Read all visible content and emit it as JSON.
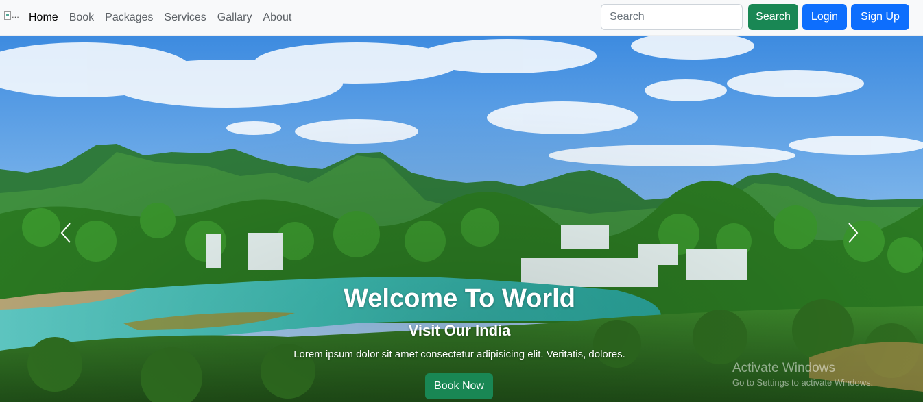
{
  "navbar": {
    "brand_alt": "...",
    "links": [
      "Home",
      "Book",
      "Packages",
      "Services",
      "Gallary",
      "About"
    ],
    "search_placeholder": "Search",
    "search_button": "Search",
    "login_button": "Login",
    "signup_button": "Sign Up"
  },
  "hero": {
    "title": "Welcome To World",
    "subtitle": "Visit Our India",
    "text": "Lorem ipsum dolor sit amet consectetur adipisicing elit. Veritatis, dolores.",
    "book_button": "Book Now",
    "prev_icon": "chevron-left-icon",
    "next_icon": "chevron-right-icon"
  },
  "watermark": {
    "title": "Activate Windows",
    "subtitle": "Go to Settings to activate Windows."
  },
  "colors": {
    "primary": "#0d6efd",
    "success": "#198754",
    "navbar_bg": "#f8f9fa"
  }
}
